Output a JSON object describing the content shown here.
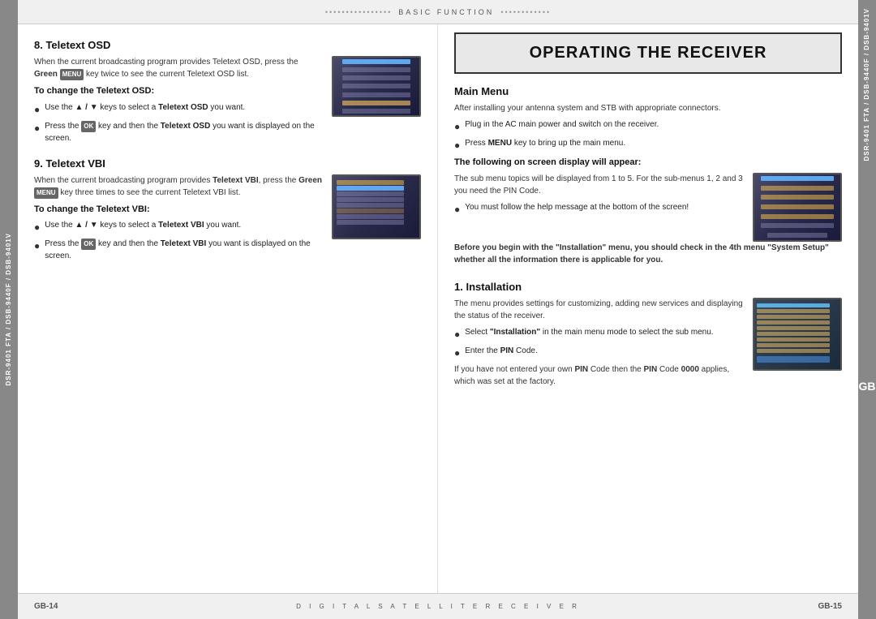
{
  "page": {
    "left_tab": "DSR-9401 FTA / DSB-9440F / DSB-9401V",
    "right_tab_top": "DSR-9401 FTA / DSB-9440F / DSB-9401V",
    "right_tab_gb": "GB",
    "top_header": {
      "dots_left": "••••••••••••••••",
      "text": "BASIC FUNCTION",
      "dots_right": "••••••••••••"
    },
    "footer_left": "GB-14",
    "footer_center": "D I G I T A L   S A T E L L I T E   R E C E I V E R",
    "footer_right": "GB-15"
  },
  "left_section": {
    "section8_title": "8. Teletext OSD",
    "section8_intro": "When the current broadcasting program provides Teletext OSD, press the Green",
    "section8_key": "MENU",
    "section8_intro2": "key twice to see the current Teletext OSD list.",
    "section8_sub_title": "To change the Teletext OSD:",
    "section8_bullet1_pre": "Use the",
    "section8_bullet1_keys": "▲ / ▼",
    "section8_bullet1_post": "keys to select a",
    "section8_bullet1_bold": "Teletext OSD",
    "section8_bullet1_end": "you want.",
    "section8_bullet2_pre": "Press the",
    "section8_bullet2_key": "OK",
    "section8_bullet2_post": "key and then the",
    "section8_bullet2_bold": "Teletext OSD",
    "section8_bullet2_end": "you want is displayed on the screen.",
    "section9_title": "9. Teletext VBI",
    "section9_intro_pre": "When the current broadcasting program provides",
    "section9_intro_bold": "Teletext VBI",
    "section9_intro2_pre": ", press the Green",
    "section9_intro2_key": "MENU",
    "section9_intro2_post": "key three times to see the current Teletext VBI list.",
    "section9_sub_title": "To change the Teletext VBI:",
    "section9_bullet1_pre": "Use the",
    "section9_bullet1_keys": "▲ / ▼",
    "section9_bullet1_post": "keys to select a",
    "section9_bullet1_bold": "Teletext VBI",
    "section9_bullet1_end": "you want.",
    "section9_bullet2_pre": "Press the",
    "section9_bullet2_key": "OK",
    "section9_bullet2_post": "key and then the",
    "section9_bullet2_bold": "Teletext VBI",
    "section9_bullet2_end": "you want is displayed on the screen."
  },
  "right_section": {
    "main_header": "OPERATING THE RECEIVER",
    "main_menu_title": "Main Menu",
    "main_menu_intro": "After installing your antenna system and STB with appropriate connectors.",
    "main_menu_bullet1": "Plug in the AC main power and switch on the receiver.",
    "main_menu_bullet2": "Press MENU key to bring up the main menu.",
    "following_bold": "The following on screen display will appear:",
    "following_desc": "The sub menu topics will be displayed from 1 to 5. For the sub-menus 1, 2 and 3 you need the PIN Code.",
    "following_bullet1": "You must follow the help message at the bottom of the screen!",
    "before_bold": "Before you begin with the \"Installation\" menu, you should check in the 4th menu \"System Setup\" whether all the information there is applicable for you.",
    "installation_title": "1. Installation",
    "installation_intro": "The menu provides settings for customizing, adding new services and displaying the status of the receiver.",
    "installation_bullet1_pre": "Select",
    "installation_bullet1_bold": "\"Installation\"",
    "installation_bullet1_post": "in the main menu mode to select the sub menu.",
    "installation_bullet2_pre": "Enter the",
    "installation_bullet2_bold": "PIN",
    "installation_bullet2_post": "Code.",
    "installation_pin_note_pre": "If you have not entered your own",
    "installation_pin_note_bold_pre": "PIN",
    "installation_pin_note_post": "Code then the",
    "installation_pin_note_bold2": "PIN",
    "installation_pin_note_code": "Code 0000",
    "installation_pin_note_end": "applies, which was set at the factory."
  }
}
